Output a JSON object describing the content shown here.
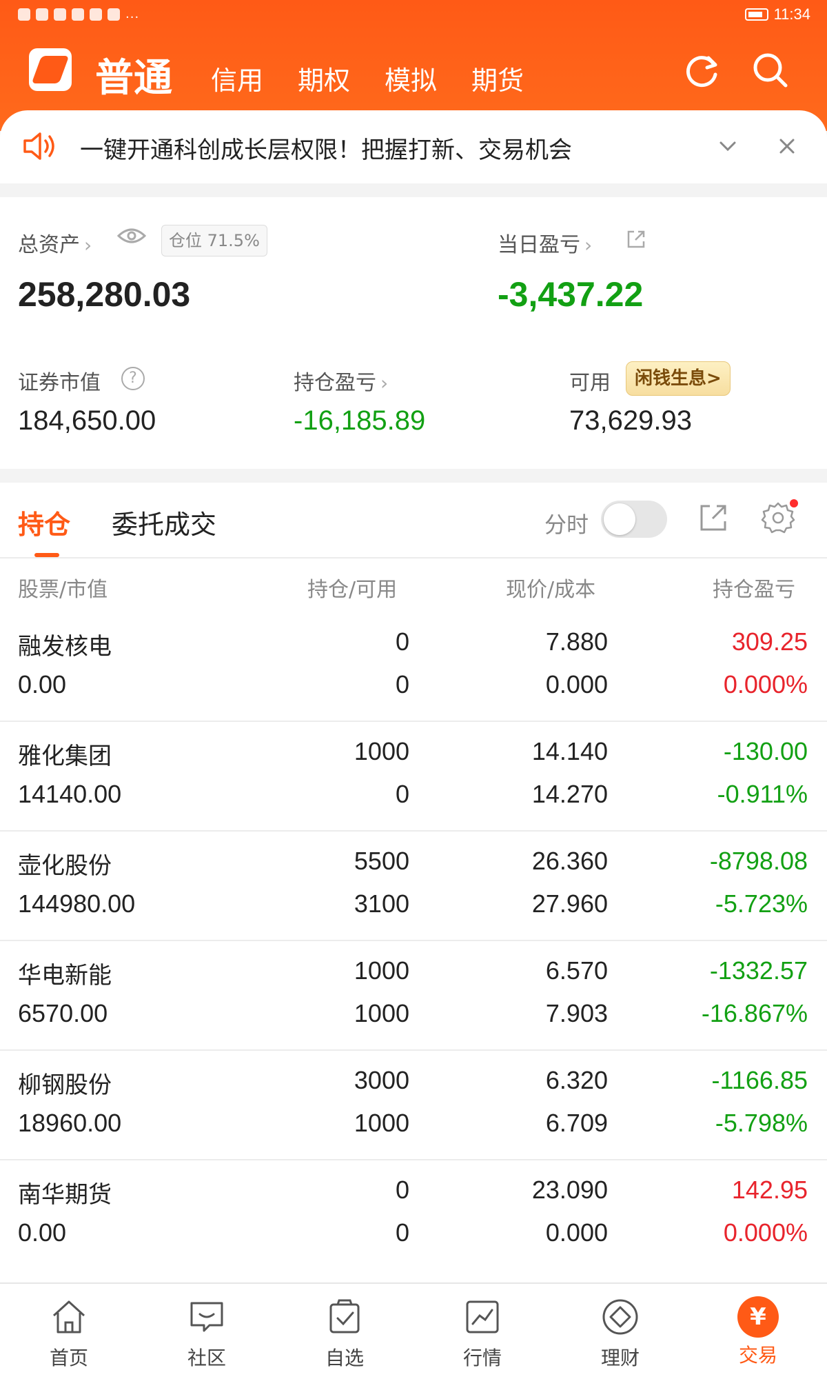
{
  "status_bar": {
    "time": "11:34",
    "more": "..."
  },
  "nav": {
    "active_tab": "普通",
    "tabs": [
      "信用",
      "期权",
      "模拟",
      "期货"
    ]
  },
  "banner": {
    "text": "一键开通科创成长层权限！把握打新、交易机会"
  },
  "asset": {
    "total_label": "总资产",
    "position_badge": "仓位  71.5%",
    "total_value": "258,280.03",
    "daily_pl_label": "当日盈亏",
    "daily_pl_value": "-3,437.22",
    "market_value_label": "证券市值",
    "market_value": "184,650.00",
    "holding_pl_label": "持仓盈亏",
    "holding_pl_value": "-16,185.89",
    "available_label": "可用",
    "available_value": "73,629.93",
    "yield_button": "闲钱生息>"
  },
  "holdings": {
    "tab_active": "持仓",
    "tab_inactive": "委托成交",
    "fenshi_label": "分时",
    "columns": [
      "股票/市值",
      "持仓/可用",
      "现价/成本",
      "持仓盈亏"
    ],
    "rows": [
      {
        "name": "融发核电",
        "mv": "0.00",
        "pos": "0",
        "avail": "0",
        "price": "7.880",
        "cost": "0.000",
        "pl": "309.25",
        "plpct": "0.000%",
        "trend": "up"
      },
      {
        "name": "雅化集团",
        "mv": "14140.00",
        "pos": "1000",
        "avail": "0",
        "price": "14.140",
        "cost": "14.270",
        "pl": "-130.00",
        "plpct": "-0.911%",
        "trend": "down"
      },
      {
        "name": "壶化股份",
        "mv": "144980.00",
        "pos": "5500",
        "avail": "3100",
        "price": "26.360",
        "cost": "27.960",
        "pl": "-8798.08",
        "plpct": "-5.723%",
        "trend": "down"
      },
      {
        "name": "华电新能",
        "mv": "6570.00",
        "pos": "1000",
        "avail": "1000",
        "price": "6.570",
        "cost": "7.903",
        "pl": "-1332.57",
        "plpct": "-16.867%",
        "trend": "down"
      },
      {
        "name": "柳钢股份",
        "mv": "18960.00",
        "pos": "3000",
        "avail": "1000",
        "price": "6.320",
        "cost": "6.709",
        "pl": "-1166.85",
        "plpct": "-5.798%",
        "trend": "down"
      },
      {
        "name": "南华期货",
        "mv": "0.00",
        "pos": "0",
        "avail": "0",
        "price": "23.090",
        "cost": "0.000",
        "pl": "142.95",
        "plpct": "0.000%",
        "trend": "up"
      }
    ]
  },
  "bottom_nav": {
    "items": [
      "首页",
      "社区",
      "自选",
      "行情",
      "理财",
      "交易"
    ],
    "trade_symbol": "¥"
  },
  "colors": {
    "accent": "#ff5a16",
    "up": "#e8242c",
    "down": "#12a013"
  }
}
